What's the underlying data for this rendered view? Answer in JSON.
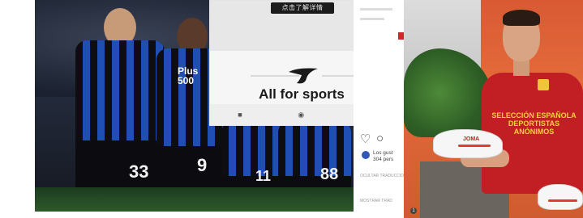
{
  "phone": {
    "button_label": "点击了解详情",
    "tagline": "All for sports",
    "nav_icons": [
      "square-icon",
      "circle-icon",
      "back-triangle-icon"
    ]
  },
  "football": {
    "numbers": [
      "33",
      "9",
      "11",
      "88"
    ],
    "sponsor": "Plus\n500"
  },
  "insta": {
    "line1": "Los gust",
    "line2": "304 pers",
    "line3": "OCULTAR TRADUCCION",
    "line4": "MOSTRAR TRAD"
  },
  "player_photo": {
    "shirt_text": "SELECCIÓN ESPAÑOLA DEPORTISTAS ANÓNIMOS",
    "shoe_brand": "JOMA",
    "pager": "1"
  },
  "colors": {
    "atalanta_blue": "#1f4fb3",
    "spain_red": "#c21f24",
    "joma_red": "#e23b2f"
  }
}
